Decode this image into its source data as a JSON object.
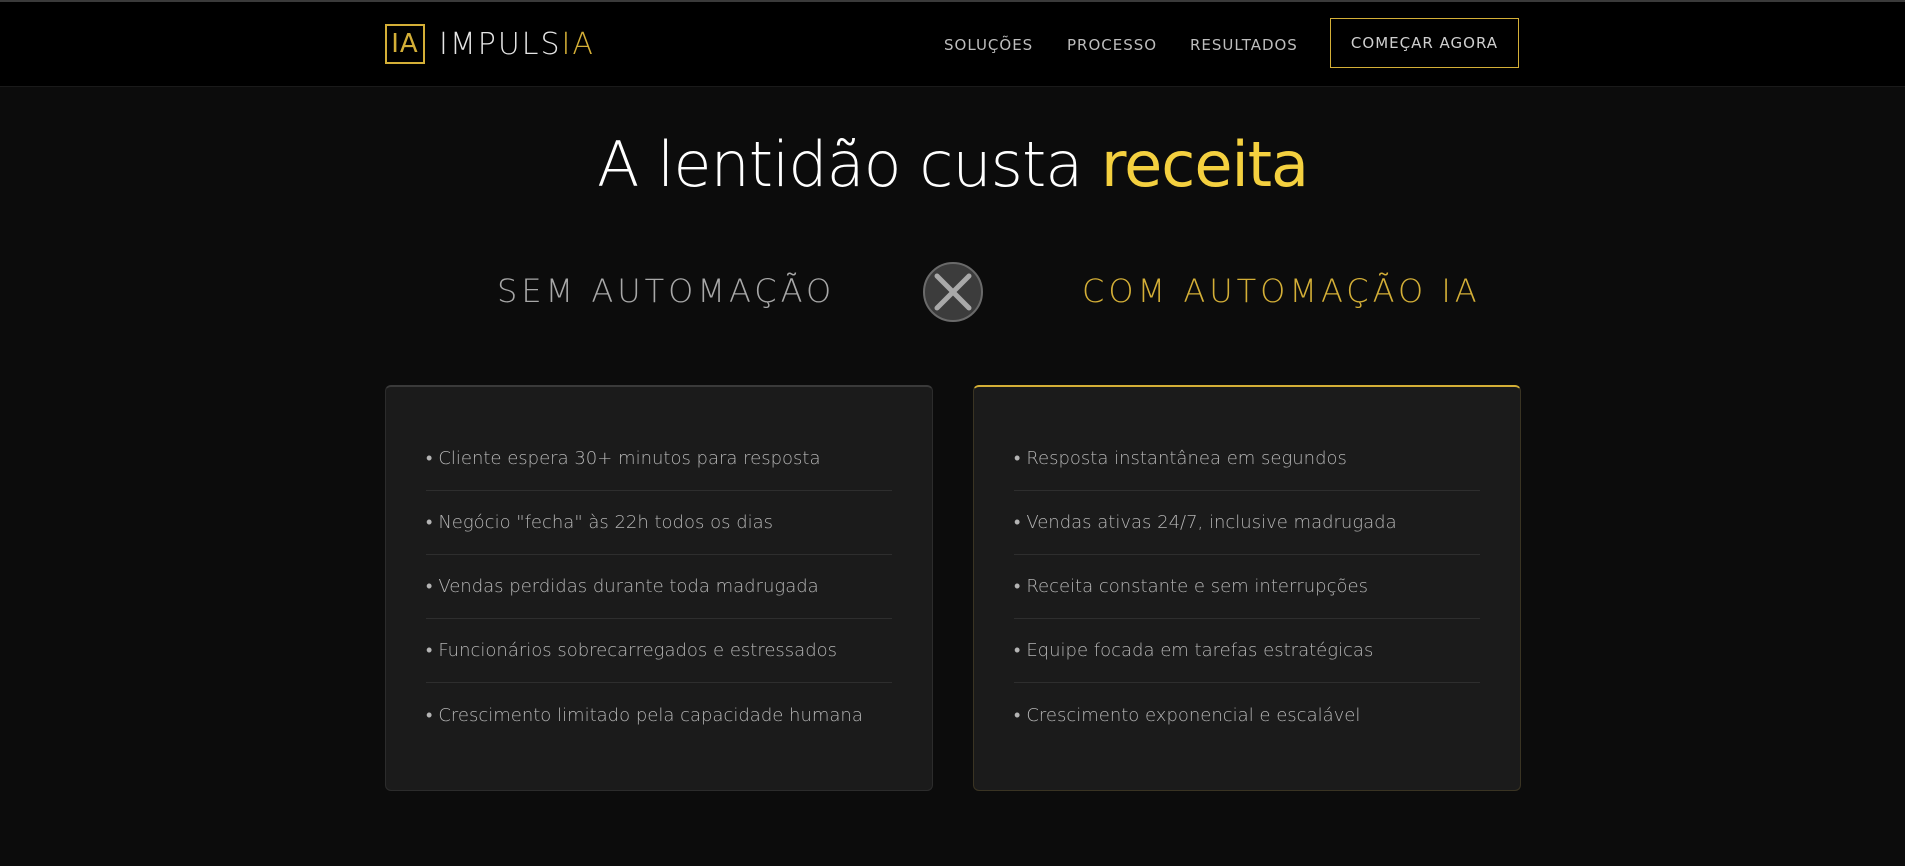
{
  "header": {
    "logo": {
      "mark": "IA",
      "name_main": "IMPULS",
      "name_accent": "IA"
    },
    "nav": [
      {
        "label": "SOLUÇÕES"
      },
      {
        "label": "PROCESSO"
      },
      {
        "label": "RESULTADOS"
      }
    ],
    "cta_label": "COMEÇAR AGORA"
  },
  "hero": {
    "title_main": "A lentidão custa ",
    "title_highlight": "receita"
  },
  "comparison": {
    "left_title": "SEM AUTOMAÇÃO",
    "right_title": "COM AUTOMAÇÃO IA",
    "divider_icon": "close-circle-icon",
    "bullet": "•",
    "left_items": [
      "Cliente espera 30+ minutos para resposta",
      "Negócio \"fecha\" às 22h todos os dias",
      "Vendas perdidas durante toda madrugada",
      "Funcionários sobrecarregados e estressados",
      "Crescimento limitado pela capacidade humana"
    ],
    "right_items": [
      "Resposta instantânea em segundos",
      "Vendas ativas 24/7, inclusive madrugada",
      "Receita constante e sem interrupções",
      "Equipe focada em tarefas estratégicas",
      "Crescimento exponencial e escalável"
    ]
  },
  "colors": {
    "background": "#0c0c0c",
    "header_bg": "#000000",
    "accent_gold": "#d4af37",
    "highlight_yellow": "#f4d03f",
    "card_bg": "#1b1b1b"
  }
}
